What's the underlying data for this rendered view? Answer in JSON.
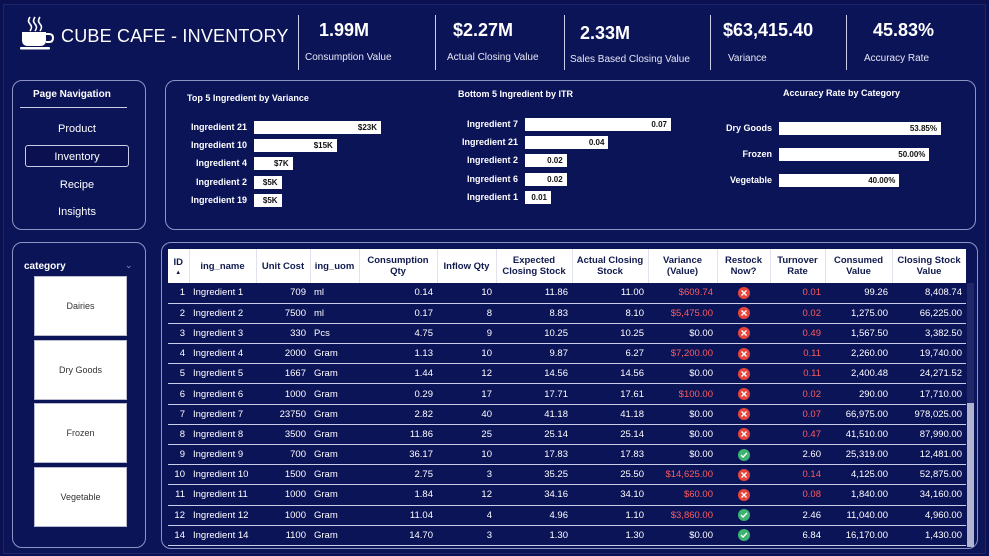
{
  "app": {
    "title": "CUBE CAFE -  INVENTORY",
    "logo_icon": "coffee-cup-icon"
  },
  "kpis": [
    {
      "value": "1.99M",
      "label": "Consumption Value"
    },
    {
      "value": "$2.27M",
      "label": "Actual Closing Value"
    },
    {
      "value": "2.33M",
      "label": "Sales Based Closing Value"
    },
    {
      "value": "$63,415.40",
      "label": "Variance"
    },
    {
      "value": "45.83%",
      "label": "Accuracy Rate"
    }
  ],
  "nav": {
    "title": "Page Navigation",
    "items": [
      "Product",
      "Inventory",
      "Recipe",
      "Insights"
    ],
    "active": "Inventory"
  },
  "category": {
    "title": "category",
    "chevron_icon": "chevron-down-icon",
    "items": [
      "Dairies",
      "Dry Goods",
      "Frozen",
      "Vegetable"
    ]
  },
  "chart_data": [
    {
      "type": "bar",
      "orientation": "horizontal",
      "title": "Top 5 Ingredient by Variance",
      "categories": [
        "Ingredient 21",
        "Ingredient 10",
        "Ingredient 4",
        "Ingredient 2",
        "Ingredient 19"
      ],
      "values": [
        23000,
        15000,
        7000,
        5000,
        5000
      ],
      "labels": [
        "$23K",
        "$15K",
        "$7K",
        "$5K",
        "$5K"
      ]
    },
    {
      "type": "bar",
      "orientation": "horizontal",
      "title": "Bottom 5 Ingredient by ITR",
      "categories": [
        "Ingredient 7",
        "Ingredient 21",
        "Ingredient 2",
        "Ingredient 6",
        "Ingredient 1"
      ],
      "values": [
        0.07,
        0.04,
        0.02,
        0.02,
        0.01
      ],
      "labels": [
        "0.07",
        "0.04",
        "0.02",
        "0.02",
        "0.01"
      ]
    },
    {
      "type": "bar",
      "orientation": "horizontal",
      "title": "Accuracy Rate by Category",
      "categories": [
        "Dry Goods",
        "Frozen",
        "Vegetable"
      ],
      "values": [
        53.85,
        50.0,
        40.0
      ],
      "labels": [
        "53.85%",
        "50.00%",
        "40.00%"
      ]
    }
  ],
  "table": {
    "columns": [
      "ID",
      "ing_name",
      "Unit Cost",
      "ing_uom",
      "Consumption Qty",
      "Inflow Qty",
      "Expected Closing Stock",
      "Actual Closing Stock",
      "Variance (Value)",
      "Restock Now?",
      "Turnover Rate",
      "Consumed Value",
      "Closing Stock Value"
    ],
    "sort_icon": "sort-ascending-icon",
    "rows": [
      [
        "1",
        "Ingredient 1",
        "709",
        "ml",
        "0.14",
        "10",
        "11.86",
        "11.00",
        "$609.74",
        "no",
        "0.01",
        "99.26",
        "8,408.74"
      ],
      [
        "2",
        "Ingredient 2",
        "7500",
        "ml",
        "0.17",
        "8",
        "8.83",
        "8.10",
        "$5,475.00",
        "no",
        "0.02",
        "1,275.00",
        "66,225.00"
      ],
      [
        "3",
        "Ingredient 3",
        "330",
        "Pcs",
        "4.75",
        "9",
        "10.25",
        "10.25",
        "$0.00",
        "no",
        "0.49",
        "1,567.50",
        "3,382.50"
      ],
      [
        "4",
        "Ingredient 4",
        "2000",
        "Gram",
        "1.13",
        "10",
        "9.87",
        "6.27",
        "$7,200.00",
        "no",
        "0.11",
        "2,260.00",
        "19,740.00"
      ],
      [
        "5",
        "Ingredient 5",
        "1667",
        "Gram",
        "1.44",
        "12",
        "14.56",
        "14.56",
        "$0.00",
        "no",
        "0.11",
        "2,400.48",
        "24,271.52"
      ],
      [
        "6",
        "Ingredient 6",
        "1000",
        "Gram",
        "0.29",
        "17",
        "17.71",
        "17.61",
        "$100.00",
        "no",
        "0.02",
        "290.00",
        "17,710.00"
      ],
      [
        "7",
        "Ingredient 7",
        "23750",
        "Gram",
        "2.82",
        "40",
        "41.18",
        "41.18",
        "$0.00",
        "no",
        "0.07",
        "66,975.00",
        "978,025.00"
      ],
      [
        "8",
        "Ingredient 8",
        "3500",
        "Gram",
        "11.86",
        "25",
        "25.14",
        "25.14",
        "$0.00",
        "no",
        "0.47",
        "41,510.00",
        "87,990.00"
      ],
      [
        "9",
        "Ingredient 9",
        "700",
        "Gram",
        "36.17",
        "10",
        "17.83",
        "17.83",
        "$0.00",
        "yes",
        "2.60",
        "25,319.00",
        "12,481.00"
      ],
      [
        "10",
        "Ingredient 10",
        "1500",
        "Gram",
        "2.75",
        "3",
        "35.25",
        "25.50",
        "$14,625.00",
        "no",
        "0.14",
        "4,125.00",
        "52,875.00"
      ],
      [
        "11",
        "Ingredient 11",
        "1000",
        "Gram",
        "1.84",
        "12",
        "34.16",
        "34.10",
        "$60.00",
        "no",
        "0.08",
        "1,840.00",
        "34,160.00"
      ],
      [
        "12",
        "Ingredient 12",
        "1000",
        "Gram",
        "11.04",
        "4",
        "4.96",
        "1.10",
        "$3,860.00",
        "yes",
        "2.46",
        "11,040.00",
        "4,960.00"
      ],
      [
        "14",
        "Ingredient 14",
        "1100",
        "Gram",
        "14.70",
        "3",
        "1.30",
        "1.30",
        "$0.00",
        "yes",
        "6.84",
        "16,170.00",
        "1,430.00"
      ]
    ],
    "restock_icons": {
      "no": "x-circle-icon",
      "yes": "check-circle-icon"
    },
    "colors": {
      "red": "#ff5b5b",
      "no": "#e8443a",
      "yes": "#3cb371"
    }
  }
}
